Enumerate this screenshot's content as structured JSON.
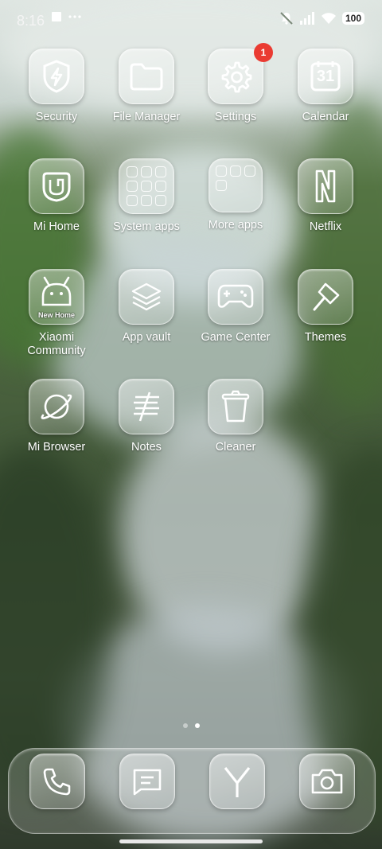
{
  "status_bar": {
    "time": "8:16",
    "left_icons": [
      "notification-square-icon",
      "more-dots-icon"
    ],
    "right_icons": [
      "silent-bell-icon",
      "signal-icon",
      "wifi-icon",
      "battery-icon"
    ],
    "battery": "100"
  },
  "apps": [
    {
      "label": "Security",
      "icon": "shield-bolt-icon"
    },
    {
      "label": "File Manager",
      "icon": "folder-icon"
    },
    {
      "label": "Settings",
      "icon": "gear-icon",
      "badge": "1"
    },
    {
      "label": "Calendar",
      "icon": "calendar-icon",
      "icon_text": "31"
    },
    {
      "label": "Mi Home",
      "icon": "mi-home-icon"
    },
    {
      "label": "System apps",
      "icon": "folder-grid-icon"
    },
    {
      "label": "More apps",
      "icon": "folder-grid-icon"
    },
    {
      "label": "Netflix",
      "icon": "netflix-n-icon"
    },
    {
      "label": "Xiaomi Community",
      "icon": "xiaomi-community-icon",
      "icon_text": "New Home"
    },
    {
      "label": "App vault",
      "icon": "layers-icon"
    },
    {
      "label": "Game Center",
      "icon": "gamepad-icon"
    },
    {
      "label": "Themes",
      "icon": "paint-brush-icon"
    },
    {
      "label": "Mi Browser",
      "icon": "planet-icon"
    },
    {
      "label": "Notes",
      "icon": "notes-icon"
    },
    {
      "label": "Cleaner",
      "icon": "trash-icon"
    }
  ],
  "page_indicator": {
    "pages": 2,
    "active": 2
  },
  "dock": [
    "phone-icon",
    "messages-icon",
    "yandex-y-icon",
    "camera-icon"
  ],
  "colors": {
    "badge": "#ea3b32"
  }
}
